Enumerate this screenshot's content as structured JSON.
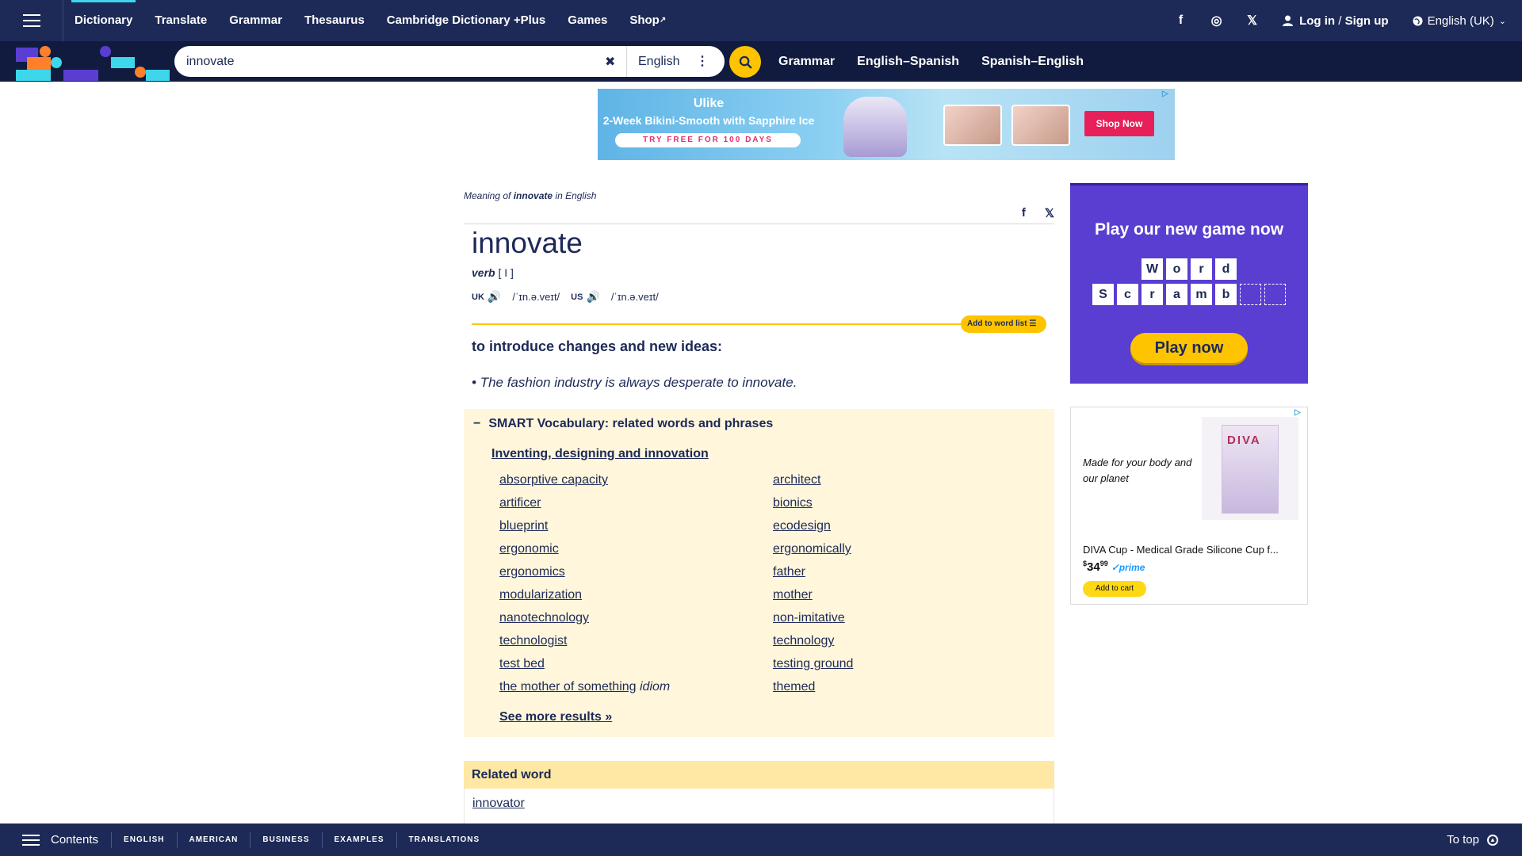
{
  "nav": {
    "links": [
      "Dictionary",
      "Translate",
      "Grammar",
      "Thesaurus",
      "Cambridge Dictionary +Plus",
      "Games",
      "Shop"
    ],
    "social": [
      "f",
      "◎",
      "𝕏"
    ],
    "login": "Log in",
    "slash": " / ",
    "signup": "Sign up",
    "language": "English (UK)"
  },
  "search": {
    "value": "innovate",
    "dictionary": "English",
    "quicklinks": [
      "Grammar",
      "English–Spanish",
      "Spanish–English"
    ]
  },
  "top_ad": {
    "brand": "Ulike",
    "headline": "2-Week Bikini-Smooth with Sapphire Ice",
    "cta_free": "TRY FREE FOR 100 DAYS",
    "cta": "Shop Now"
  },
  "entry": {
    "meaning_prefix": "Meaning of ",
    "meaning_word": "innovate",
    "meaning_suffix": " in English",
    "headword": "innovate",
    "pos": "verb",
    "grammar": " [ I ]",
    "uk_label": "UK",
    "uk_ipa": "/ˈɪn.ə.veɪt/",
    "us_label": "US",
    "us_ipa": "/ˈɪn.ə.veɪt/",
    "wordlist_btn": "Add to word list",
    "definition": "to introduce changes and new ideas:",
    "example": "The fashion industry is always desperate to innovate."
  },
  "smart_vocab": {
    "title": "SMART Vocabulary: related words and phrases",
    "subtitle": "Inventing, designing and innovation",
    "words": [
      "absorptive capacity",
      "architect",
      "artificer",
      "bionics",
      "blueprint",
      "ecodesign",
      "ergonomic",
      "ergonomically",
      "ergonomics",
      "father",
      "modularization",
      "mother",
      "nanotechnology",
      "non-imitative",
      "technologist",
      "technology",
      "test bed",
      "testing ground",
      "the mother of something",
      "themed"
    ],
    "idiom_label": "idiom",
    "see_more": "See more results »"
  },
  "related": {
    "heading": "Related word",
    "word": "innovator"
  },
  "game_ad": {
    "title": "Play our new game now",
    "row1": [
      "W",
      "o",
      "r",
      "d"
    ],
    "row2": [
      "S",
      "c",
      "r",
      "a",
      "m",
      "b",
      "",
      ""
    ],
    "cta": "Play now"
  },
  "product_ad": {
    "tagline": "Made for your body and our planet",
    "box_brand": "DIVA",
    "title": "DIVA Cup - Medical Grade Silicone Cup f...",
    "price_currency": "$",
    "price_main": "34",
    "price_cents": "99",
    "prime": "✓prime",
    "cta": "Add to cart"
  },
  "bottom_bar": {
    "contents": "Contents",
    "sections": [
      "ENGLISH",
      "AMERICAN",
      "BUSINESS",
      "EXAMPLES",
      "TRANSLATIONS"
    ],
    "to_top": "To top"
  },
  "colors": {
    "navy": "#1d2a57",
    "yellow": "#fec400",
    "cyan": "#3dd6ea",
    "smart_bg": "#fff6dc"
  }
}
